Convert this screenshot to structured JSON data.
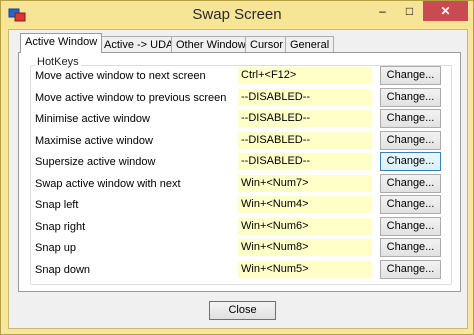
{
  "window": {
    "title": "Swap Screen",
    "controls": {
      "minimize": "–",
      "maximize": "□",
      "close": "✕"
    }
  },
  "tabs": [
    {
      "label": "Active Window",
      "active": true
    },
    {
      "label": "Active -> UDA",
      "active": false
    },
    {
      "label": "Other Windows",
      "active": false
    },
    {
      "label": "Cursor",
      "active": false
    },
    {
      "label": "General",
      "active": false
    }
  ],
  "group": {
    "legend": "HotKeys"
  },
  "hotkeys": [
    {
      "label": "Move active window to next screen",
      "value": "Ctrl+<F12>",
      "button": "Change..."
    },
    {
      "label": "Move active window to previous screen",
      "value": "--DISABLED--",
      "button": "Change..."
    },
    {
      "label": "Minimise active window",
      "value": "--DISABLED--",
      "button": "Change..."
    },
    {
      "label": "Maximise active window",
      "value": "--DISABLED--",
      "button": "Change..."
    },
    {
      "label": "Supersize active window",
      "value": "--DISABLED--",
      "button": "Change..."
    },
    {
      "label": "Swap active window with next",
      "value": "Win+<Num7>",
      "button": "Change..."
    },
    {
      "label": "Snap left",
      "value": "Win+<Num4>",
      "button": "Change..."
    },
    {
      "label": "Snap right",
      "value": "Win+<Num6>",
      "button": "Change..."
    },
    {
      "label": "Snap up",
      "value": "Win+<Num8>",
      "button": "Change..."
    },
    {
      "label": "Snap down",
      "value": "Win+<Num5>",
      "button": "Change..."
    }
  ],
  "footer": {
    "close_label": "Close"
  },
  "colors": {
    "frame": "#f7e69c",
    "close_control": "#c74b50",
    "hotkey_field": "#ffffc8"
  }
}
